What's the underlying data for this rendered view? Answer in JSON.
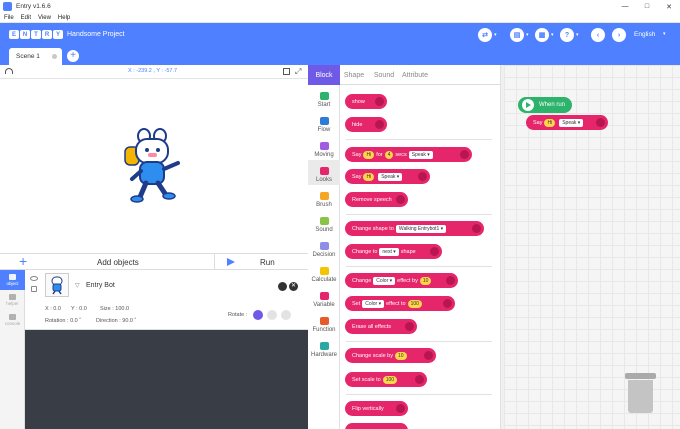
{
  "window": {
    "title": "Entry v1.6.6"
  },
  "menu": [
    "File",
    "Edit",
    "View",
    "Help"
  ],
  "header": {
    "project_name": "Handsome Project",
    "language": "English",
    "logo": "ENTRY"
  },
  "scene": {
    "tab_label": "Scene 1"
  },
  "stage": {
    "coords": "X : -239.2 , Y : -57.7"
  },
  "controls": {
    "add_objects": "Add objects",
    "run": "Run"
  },
  "object_panel": {
    "tabs": [
      "object",
      "helper",
      "console"
    ],
    "name": "Entry Bot",
    "x": "X : 0.0",
    "y": "Y : 0.0",
    "size": "Size : 100.0",
    "rotation": "Rotation : 0.0 ˚",
    "direction": "Direction : 90.0 ˚",
    "rotate_label": "Rotate :"
  },
  "palette": {
    "tabs": [
      "Block",
      "Shape",
      "Sound",
      "Attribute"
    ],
    "categories": [
      {
        "label": "Start",
        "color": "#2db36b"
      },
      {
        "label": "Flow",
        "color": "#2e7cd8"
      },
      {
        "label": "Moving",
        "color": "#a15be0"
      },
      {
        "label": "Looks",
        "color": "#e5266a"
      },
      {
        "label": "Brush",
        "color": "#f5a623"
      },
      {
        "label": "Sound",
        "color": "#8bc34a"
      },
      {
        "label": "Decision",
        "color": "#8e8ee6"
      },
      {
        "label": "Calculate",
        "color": "#f3c400"
      },
      {
        "label": "Variable",
        "color": "#e5266a"
      },
      {
        "label": "Function",
        "color": "#e75a2a"
      },
      {
        "label": "Hardware",
        "color": "#2aa9a3"
      }
    ],
    "blocks": {
      "show": "show",
      "hide": "hide",
      "say_for": {
        "say": "Say",
        "msg": "Hi",
        "for": "for",
        "secs_val": "4",
        "secs": "secs",
        "mode": "Speak ▾"
      },
      "say": {
        "say": "Say",
        "msg": "Hi",
        "mode": "Speak ▾"
      },
      "remove_speech": "Remove speech",
      "change_shape_to": {
        "text": "Change shape to",
        "value": "Walking Entrybot1 ▾"
      },
      "change_to_shape": {
        "text": "Change to",
        "value": "next ▾",
        "suffix": "shape"
      },
      "change_effect": {
        "text": "Change",
        "value": "Color ▾",
        "mid": "effect by",
        "num": "10"
      },
      "set_effect": {
        "text": "Set",
        "value": "Color ▾",
        "mid": "effect to",
        "num": "100"
      },
      "erase_effects": "Erase all effects",
      "change_scale": {
        "text": "Change scale by",
        "num": "10"
      },
      "set_scale": {
        "text": "Set scale to",
        "num": "100"
      },
      "flip_vertically": "Flip vertically"
    }
  },
  "workspace": {
    "start_block": "When run",
    "say_block": {
      "say": "Say",
      "msg": "Hi",
      "mode": "Speak ▾"
    }
  }
}
